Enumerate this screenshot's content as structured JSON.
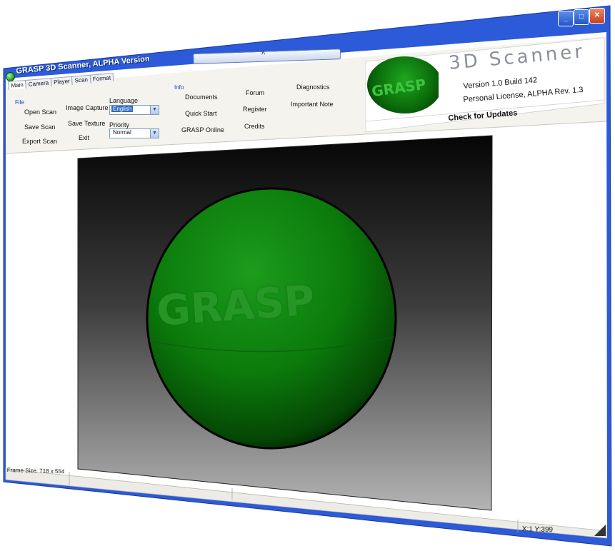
{
  "window": {
    "title": "GRASP 3D Scanner, ALPHA Version",
    "controls": {
      "minimize": "_",
      "maximize": "□",
      "close": "✕"
    },
    "collapse_arrow": "^"
  },
  "tabs": [
    "Main",
    "Camera",
    "Player",
    "Scan",
    "Format"
  ],
  "file_group": {
    "label": "File",
    "buttons": {
      "open_scan": "Open Scan",
      "save_scan": "Save Scan",
      "export_scan": "Export Scan",
      "image_capture": "Image Capture",
      "save_texture": "Save Texture",
      "exit": "Exit"
    },
    "language_label": "Language",
    "language_value": "English",
    "priority_label": "Priority",
    "priority_value": "Normal"
  },
  "info_group": {
    "label": "Info",
    "links": {
      "documents": "Documents",
      "quick_start": "Quick Start",
      "grasp_online": "GRASP Online",
      "forum": "Forum",
      "register": "Register",
      "credits": "Credits",
      "diagnostics": "Diagnostics",
      "important_note": "Important Note"
    }
  },
  "branding": {
    "logo_text": "GRASP",
    "product": "3D Scanner",
    "version": "Version 1.0  Build 142",
    "license": "Personal License, ALPHA Rev. 1.3",
    "updates": "Check for Updates"
  },
  "viewport": {
    "sphere_text": "GRASP",
    "sphere_color": "#0b7a0b"
  },
  "status": {
    "frame_size": "Frame Size: 718 x 554",
    "coords": "X:1 Y:399"
  },
  "colors": {
    "titlebar": "#1e4fd0",
    "accent_link": "#1a3fd0"
  }
}
